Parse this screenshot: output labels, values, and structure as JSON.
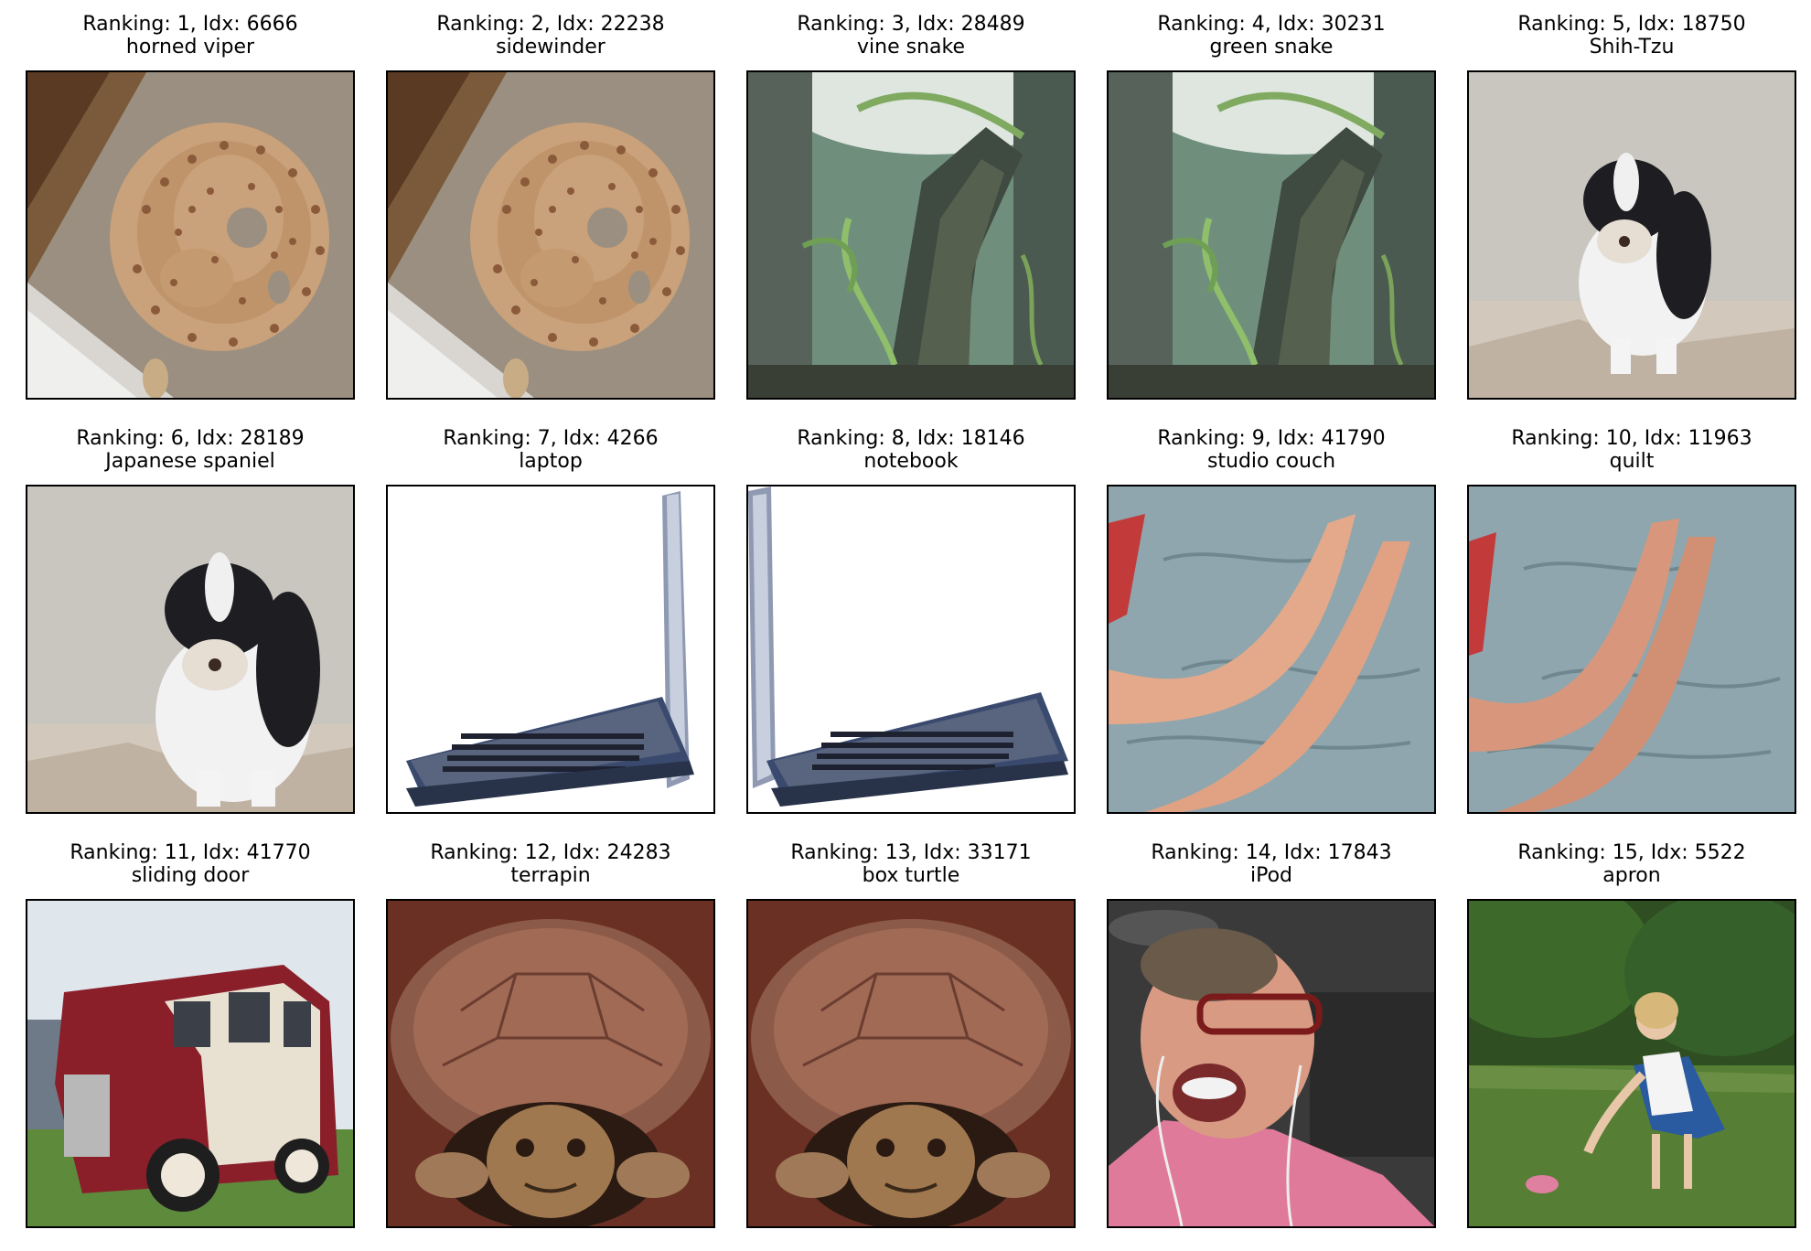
{
  "panels": [
    {
      "title": "Ranking: 1, Idx: 6666",
      "label": "horned viper",
      "scene": "snake-coiled"
    },
    {
      "title": "Ranking: 2, Idx: 22238",
      "label": "sidewinder",
      "scene": "snake-coiled"
    },
    {
      "title": "Ranking: 3, Idx: 28489",
      "label": "vine snake",
      "scene": "snake-tree"
    },
    {
      "title": "Ranking: 4, Idx: 30231",
      "label": "green snake",
      "scene": "snake-tree"
    },
    {
      "title": "Ranking: 5, Idx: 18750",
      "label": "Shih-Tzu",
      "scene": "dog"
    },
    {
      "title": "Ranking: 6, Idx: 28189",
      "label": "Japanese spaniel",
      "scene": "dog-zoom"
    },
    {
      "title": "Ranking: 7, Idx: 4266",
      "label": "laptop",
      "scene": "laptop-a"
    },
    {
      "title": "Ranking: 8, Idx: 18146",
      "label": "notebook",
      "scene": "laptop-b"
    },
    {
      "title": "Ranking: 9, Idx: 41790",
      "label": "studio couch",
      "scene": "legs-a"
    },
    {
      "title": "Ranking: 10, Idx: 11963",
      "label": "quilt",
      "scene": "legs-b"
    },
    {
      "title": "Ranking: 11, Idx: 41770",
      "label": "sliding door",
      "scene": "van"
    },
    {
      "title": "Ranking: 12, Idx: 24283",
      "label": "terrapin",
      "scene": "turtle"
    },
    {
      "title": "Ranking: 13, Idx: 33171",
      "label": "box turtle",
      "scene": "turtle"
    },
    {
      "title": "Ranking: 14, Idx: 17843",
      "label": "iPod",
      "scene": "man"
    },
    {
      "title": "Ranking: 15, Idx: 5522",
      "label": "apron",
      "scene": "woman-garden"
    }
  ]
}
